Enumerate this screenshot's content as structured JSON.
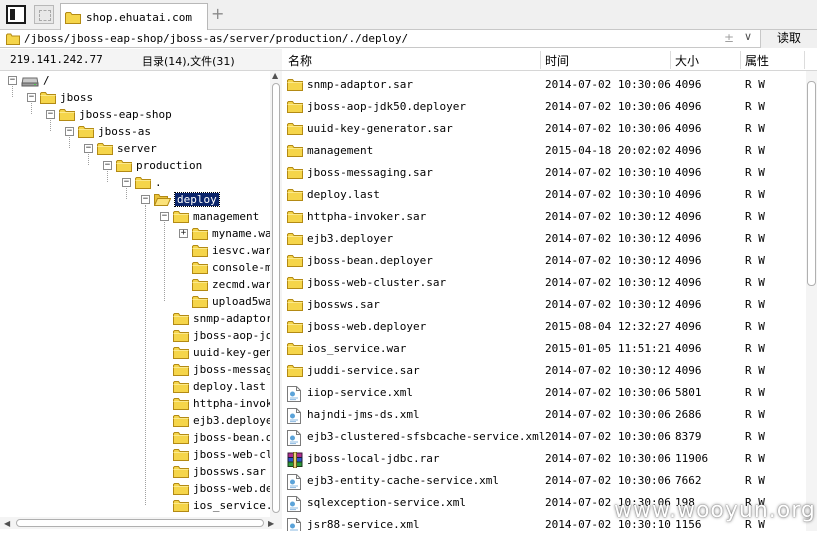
{
  "tab": {
    "label": "shop.ehuatai.com",
    "add_symbol": "+"
  },
  "address": {
    "path": "/jboss/jboss-eap-shop/jboss-as/server/production/./deploy/",
    "split_symbol": "±",
    "dropdown_symbol": "∨",
    "read_label": "读取"
  },
  "info": {
    "ip": "219.141.242.77",
    "counts": "目录(14),文件(31)"
  },
  "tree": [
    {
      "label": "/",
      "level": 0,
      "toggle": "−",
      "icon": "drive-icon"
    },
    {
      "label": "jboss",
      "level": 1,
      "toggle": "−",
      "icon": "folder-icon"
    },
    {
      "label": "jboss-eap-shop",
      "level": 2,
      "toggle": "−",
      "icon": "folder-icon"
    },
    {
      "label": "jboss-as",
      "level": 3,
      "toggle": "−",
      "icon": "folder-icon"
    },
    {
      "label": "server",
      "level": 4,
      "toggle": "−",
      "icon": "folder-icon"
    },
    {
      "label": "production",
      "level": 5,
      "toggle": "−",
      "icon": "folder-icon"
    },
    {
      "label": ".",
      "level": 6,
      "toggle": "−",
      "icon": "folder-icon"
    },
    {
      "label": "deploy",
      "level": 7,
      "toggle": "−",
      "icon": "folder-open-icon",
      "selected": true
    },
    {
      "label": "management",
      "level": 8,
      "toggle": "−",
      "icon": "folder-icon"
    },
    {
      "label": "myname.wa",
      "level": 9,
      "toggle": "+",
      "icon": "folder-icon"
    },
    {
      "label": "iesvc.war",
      "level": 9,
      "toggle": "",
      "icon": "folder-icon"
    },
    {
      "label": "console-m",
      "level": 9,
      "toggle": "",
      "icon": "folder-icon"
    },
    {
      "label": "zecmd.war",
      "level": 9,
      "toggle": "",
      "icon": "folder-icon"
    },
    {
      "label": "upload5wa",
      "level": 9,
      "toggle": "",
      "icon": "folder-icon"
    },
    {
      "label": "snmp-adaptor",
      "level": 8,
      "toggle": "",
      "icon": "folder-icon"
    },
    {
      "label": "jboss-aop-jdk",
      "level": 8,
      "toggle": "",
      "icon": "folder-icon"
    },
    {
      "label": "uuid-key-gen",
      "level": 8,
      "toggle": "",
      "icon": "folder-icon"
    },
    {
      "label": "jboss-messag",
      "level": 8,
      "toggle": "",
      "icon": "folder-icon"
    },
    {
      "label": "deploy.last",
      "level": 8,
      "toggle": "",
      "icon": "folder-icon"
    },
    {
      "label": "httpha-invok",
      "level": 8,
      "toggle": "",
      "icon": "folder-icon"
    },
    {
      "label": "ejb3.deploye",
      "level": 8,
      "toggle": "",
      "icon": "folder-icon"
    },
    {
      "label": "jboss-bean.d",
      "level": 8,
      "toggle": "",
      "icon": "folder-icon"
    },
    {
      "label": "jboss-web-cl",
      "level": 8,
      "toggle": "",
      "icon": "folder-icon"
    },
    {
      "label": "jbossws.sar",
      "level": 8,
      "toggle": "",
      "icon": "folder-icon"
    },
    {
      "label": "jboss-web.de",
      "level": 8,
      "toggle": "",
      "icon": "folder-icon"
    },
    {
      "label": "ios_service.",
      "level": 8,
      "toggle": "",
      "icon": "folder-icon"
    }
  ],
  "columns": {
    "name": "名称",
    "time": "时间",
    "size": "大小",
    "attr": "属性"
  },
  "files": [
    {
      "name": "snmp-adaptor.sar",
      "time": "2014-07-02 10:30:06",
      "size": "4096",
      "attr": "R W",
      "icon": "folder-icon"
    },
    {
      "name": "jboss-aop-jdk50.deployer",
      "time": "2014-07-02 10:30:06",
      "size": "4096",
      "attr": "R W",
      "icon": "folder-icon"
    },
    {
      "name": "uuid-key-generator.sar",
      "time": "2014-07-02 10:30:06",
      "size": "4096",
      "attr": "R W",
      "icon": "folder-icon"
    },
    {
      "name": "management",
      "time": "2015-04-18 20:02:02",
      "size": "4096",
      "attr": "R W",
      "icon": "folder-icon"
    },
    {
      "name": "jboss-messaging.sar",
      "time": "2014-07-02 10:30:10",
      "size": "4096",
      "attr": "R W",
      "icon": "folder-icon"
    },
    {
      "name": "deploy.last",
      "time": "2014-07-02 10:30:10",
      "size": "4096",
      "attr": "R W",
      "icon": "folder-icon"
    },
    {
      "name": "httpha-invoker.sar",
      "time": "2014-07-02 10:30:12",
      "size": "4096",
      "attr": "R W",
      "icon": "folder-icon"
    },
    {
      "name": "ejb3.deployer",
      "time": "2014-07-02 10:30:12",
      "size": "4096",
      "attr": "R W",
      "icon": "folder-icon"
    },
    {
      "name": "jboss-bean.deployer",
      "time": "2014-07-02 10:30:12",
      "size": "4096",
      "attr": "R W",
      "icon": "folder-icon"
    },
    {
      "name": "jboss-web-cluster.sar",
      "time": "2014-07-02 10:30:12",
      "size": "4096",
      "attr": "R W",
      "icon": "folder-icon"
    },
    {
      "name": "jbossws.sar",
      "time": "2014-07-02 10:30:12",
      "size": "4096",
      "attr": "R W",
      "icon": "folder-icon"
    },
    {
      "name": "jboss-web.deployer",
      "time": "2015-08-04 12:32:27",
      "size": "4096",
      "attr": "R W",
      "icon": "folder-icon"
    },
    {
      "name": "ios_service.war",
      "time": "2015-01-05 11:51:21",
      "size": "4096",
      "attr": "R W",
      "icon": "folder-icon"
    },
    {
      "name": "juddi-service.sar",
      "time": "2014-07-02 10:30:12",
      "size": "4096",
      "attr": "R W",
      "icon": "folder-icon"
    },
    {
      "name": "iiop-service.xml",
      "time": "2014-07-02 10:30:06",
      "size": "5801",
      "attr": "R W",
      "icon": "xml-file-icon"
    },
    {
      "name": "hajndi-jms-ds.xml",
      "time": "2014-07-02 10:30:06",
      "size": "2686",
      "attr": "R W",
      "icon": "xml-file-icon"
    },
    {
      "name": "ejb3-clustered-sfsbcache-service.xml",
      "time": "2014-07-02 10:30:06",
      "size": "8379",
      "attr": "R W",
      "icon": "xml-file-icon"
    },
    {
      "name": "jboss-local-jdbc.rar",
      "time": "2014-07-02 10:30:06",
      "size": "11906",
      "attr": "R W",
      "icon": "rar-archive-icon"
    },
    {
      "name": "ejb3-entity-cache-service.xml",
      "time": "2014-07-02 10:30:06",
      "size": "7662",
      "attr": "R W",
      "icon": "xml-file-icon"
    },
    {
      "name": "sqlexception-service.xml",
      "time": "2014-07-02 10:30:06",
      "size": "198",
      "attr": "R W",
      "icon": "xml-file-icon"
    },
    {
      "name": "jsr88-service.xml",
      "time": "2014-07-02 10:30:10",
      "size": "1156",
      "attr": "R W",
      "icon": "xml-file-icon"
    }
  ],
  "watermark": "www.wooyun.org",
  "colors": {
    "folder": "#f5d54a",
    "selection": "#0a246a"
  }
}
